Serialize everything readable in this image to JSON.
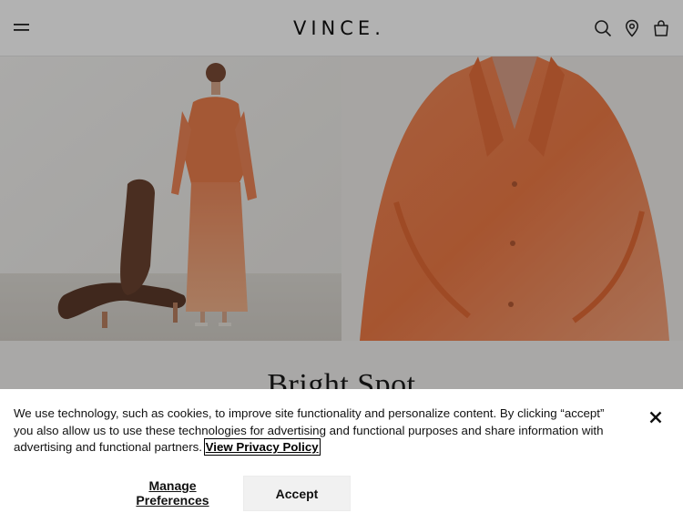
{
  "header": {
    "logo_text": "VINCE.",
    "icons": [
      "menu-icon",
      "search-icon",
      "store-locator-icon",
      "shopping-bag-icon"
    ]
  },
  "hero": {
    "left_image": "model-standing-orange-outfit-with-lounge-chair",
    "right_image": "close-up-orange-sheer-shirt"
  },
  "section": {
    "title": "Bright Spot"
  },
  "cookie_banner": {
    "text": "We use technology, such as cookies, to improve site functionality and personalize content. By clicking “accept” you also allow us to use these technologies for advertising and functional purposes and share information with advertising and functional partners.",
    "policy_link": "View Privacy Policy",
    "manage_label": "Manage Preferences",
    "accept_label": "Accept",
    "close_icon": "close-icon"
  },
  "colors": {
    "accent_orange": "#e8733f",
    "banner_bg": "#ffffff",
    "accept_bg": "#f1f1f1"
  }
}
